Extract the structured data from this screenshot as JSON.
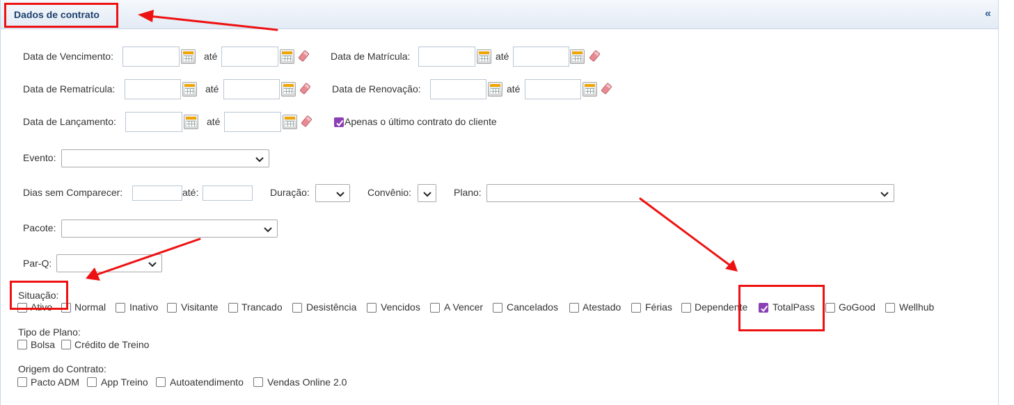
{
  "panel": {
    "title": "Dados de contrato",
    "collapse_label": "«"
  },
  "dates": {
    "vencimento": "Data de Vencimento:",
    "matricula": "Data de Matrícula:",
    "rematricula": "Data de Rematrícula:",
    "renovacao": "Data de Renovação:",
    "lancamento": "Data de Lançamento:",
    "ate": "até"
  },
  "ultimo_contrato": {
    "label": "Apenas o último contrato do cliente",
    "checked": true
  },
  "evento": {
    "label": "Evento:"
  },
  "dias": {
    "label": "Dias sem Comparecer:",
    "ate": "até:"
  },
  "duracao": {
    "label": "Duração:"
  },
  "convenio": {
    "label": "Convênio:"
  },
  "plano": {
    "label": "Plano:"
  },
  "pacote": {
    "label": "Pacote:"
  },
  "parq": {
    "label": "Par-Q:"
  },
  "situacao": {
    "label": "Situação:",
    "items": [
      {
        "label": "Ativo",
        "checked": false
      },
      {
        "label": "Normal",
        "checked": false
      },
      {
        "label": "Inativo",
        "checked": false
      },
      {
        "label": "Visitante",
        "checked": false
      },
      {
        "label": "Trancado",
        "checked": false
      },
      {
        "label": "Desistência",
        "checked": false
      },
      {
        "label": "Vencidos",
        "checked": false
      },
      {
        "label": "A Vencer",
        "checked": false
      },
      {
        "label": "Cancelados",
        "checked": false
      },
      {
        "label": "Atestado",
        "checked": false
      },
      {
        "label": "Férias",
        "checked": false
      },
      {
        "label": "Dependente",
        "checked": false
      },
      {
        "label": "TotalPass",
        "checked": true
      },
      {
        "label": "GoGood",
        "checked": false
      },
      {
        "label": "Wellhub",
        "checked": false
      }
    ]
  },
  "tipo_plano": {
    "label": "Tipo de Plano:",
    "items": [
      {
        "label": "Bolsa",
        "checked": false
      },
      {
        "label": "Crédito de Treino",
        "checked": false
      }
    ]
  },
  "origem": {
    "label": "Origem do Contrato:",
    "items": [
      {
        "label": "Pacto ADM",
        "checked": false
      },
      {
        "label": "App Treino",
        "checked": false
      },
      {
        "label": "Autoatendimento",
        "checked": false
      },
      {
        "label": "Vendas Online 2.0",
        "checked": false
      }
    ]
  },
  "icons": {
    "calendar": "calendar-icon",
    "eraser": "eraser-icon",
    "chevron": "chevron-down-icon",
    "check": "checkmark-icon"
  },
  "colors": {
    "accent_check": "#8b3fb5",
    "annotation_red": "#ee1111",
    "title_blue": "#1d3f6b"
  }
}
